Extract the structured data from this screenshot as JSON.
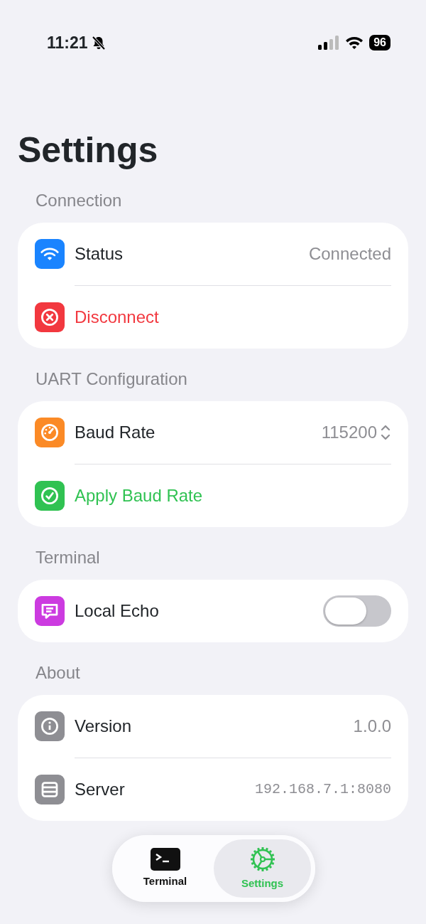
{
  "status_bar": {
    "time": "11:21",
    "battery": "96"
  },
  "title": "Settings",
  "sections": [
    {
      "header": "Connection",
      "rows": [
        {
          "kind": "value",
          "label": "Status",
          "value": "Connected",
          "color": "#1a84ff"
        },
        {
          "kind": "action",
          "label": "Disconnect",
          "color": "#f2383f"
        }
      ]
    },
    {
      "header": "UART Configuration",
      "rows": [
        {
          "kind": "picker",
          "label": "Baud Rate",
          "value": "115200",
          "color": "#fb8a26"
        },
        {
          "kind": "action",
          "label": "Apply Baud Rate",
          "color": "#30c252"
        }
      ]
    },
    {
      "header": "Terminal",
      "rows": [
        {
          "kind": "toggle",
          "label": "Local Echo",
          "on": false,
          "color": "#cc3be0"
        }
      ]
    },
    {
      "header": "About",
      "rows": [
        {
          "kind": "value",
          "label": "Version",
          "value": "1.0.0",
          "color": "#8e8e93"
        },
        {
          "kind": "mono",
          "label": "Server",
          "value": "192.168.7.1:8080",
          "color": "#8e8e93"
        }
      ]
    }
  ],
  "tabs": [
    {
      "label": "Terminal",
      "selected": false
    },
    {
      "label": "Settings",
      "selected": true
    }
  ]
}
